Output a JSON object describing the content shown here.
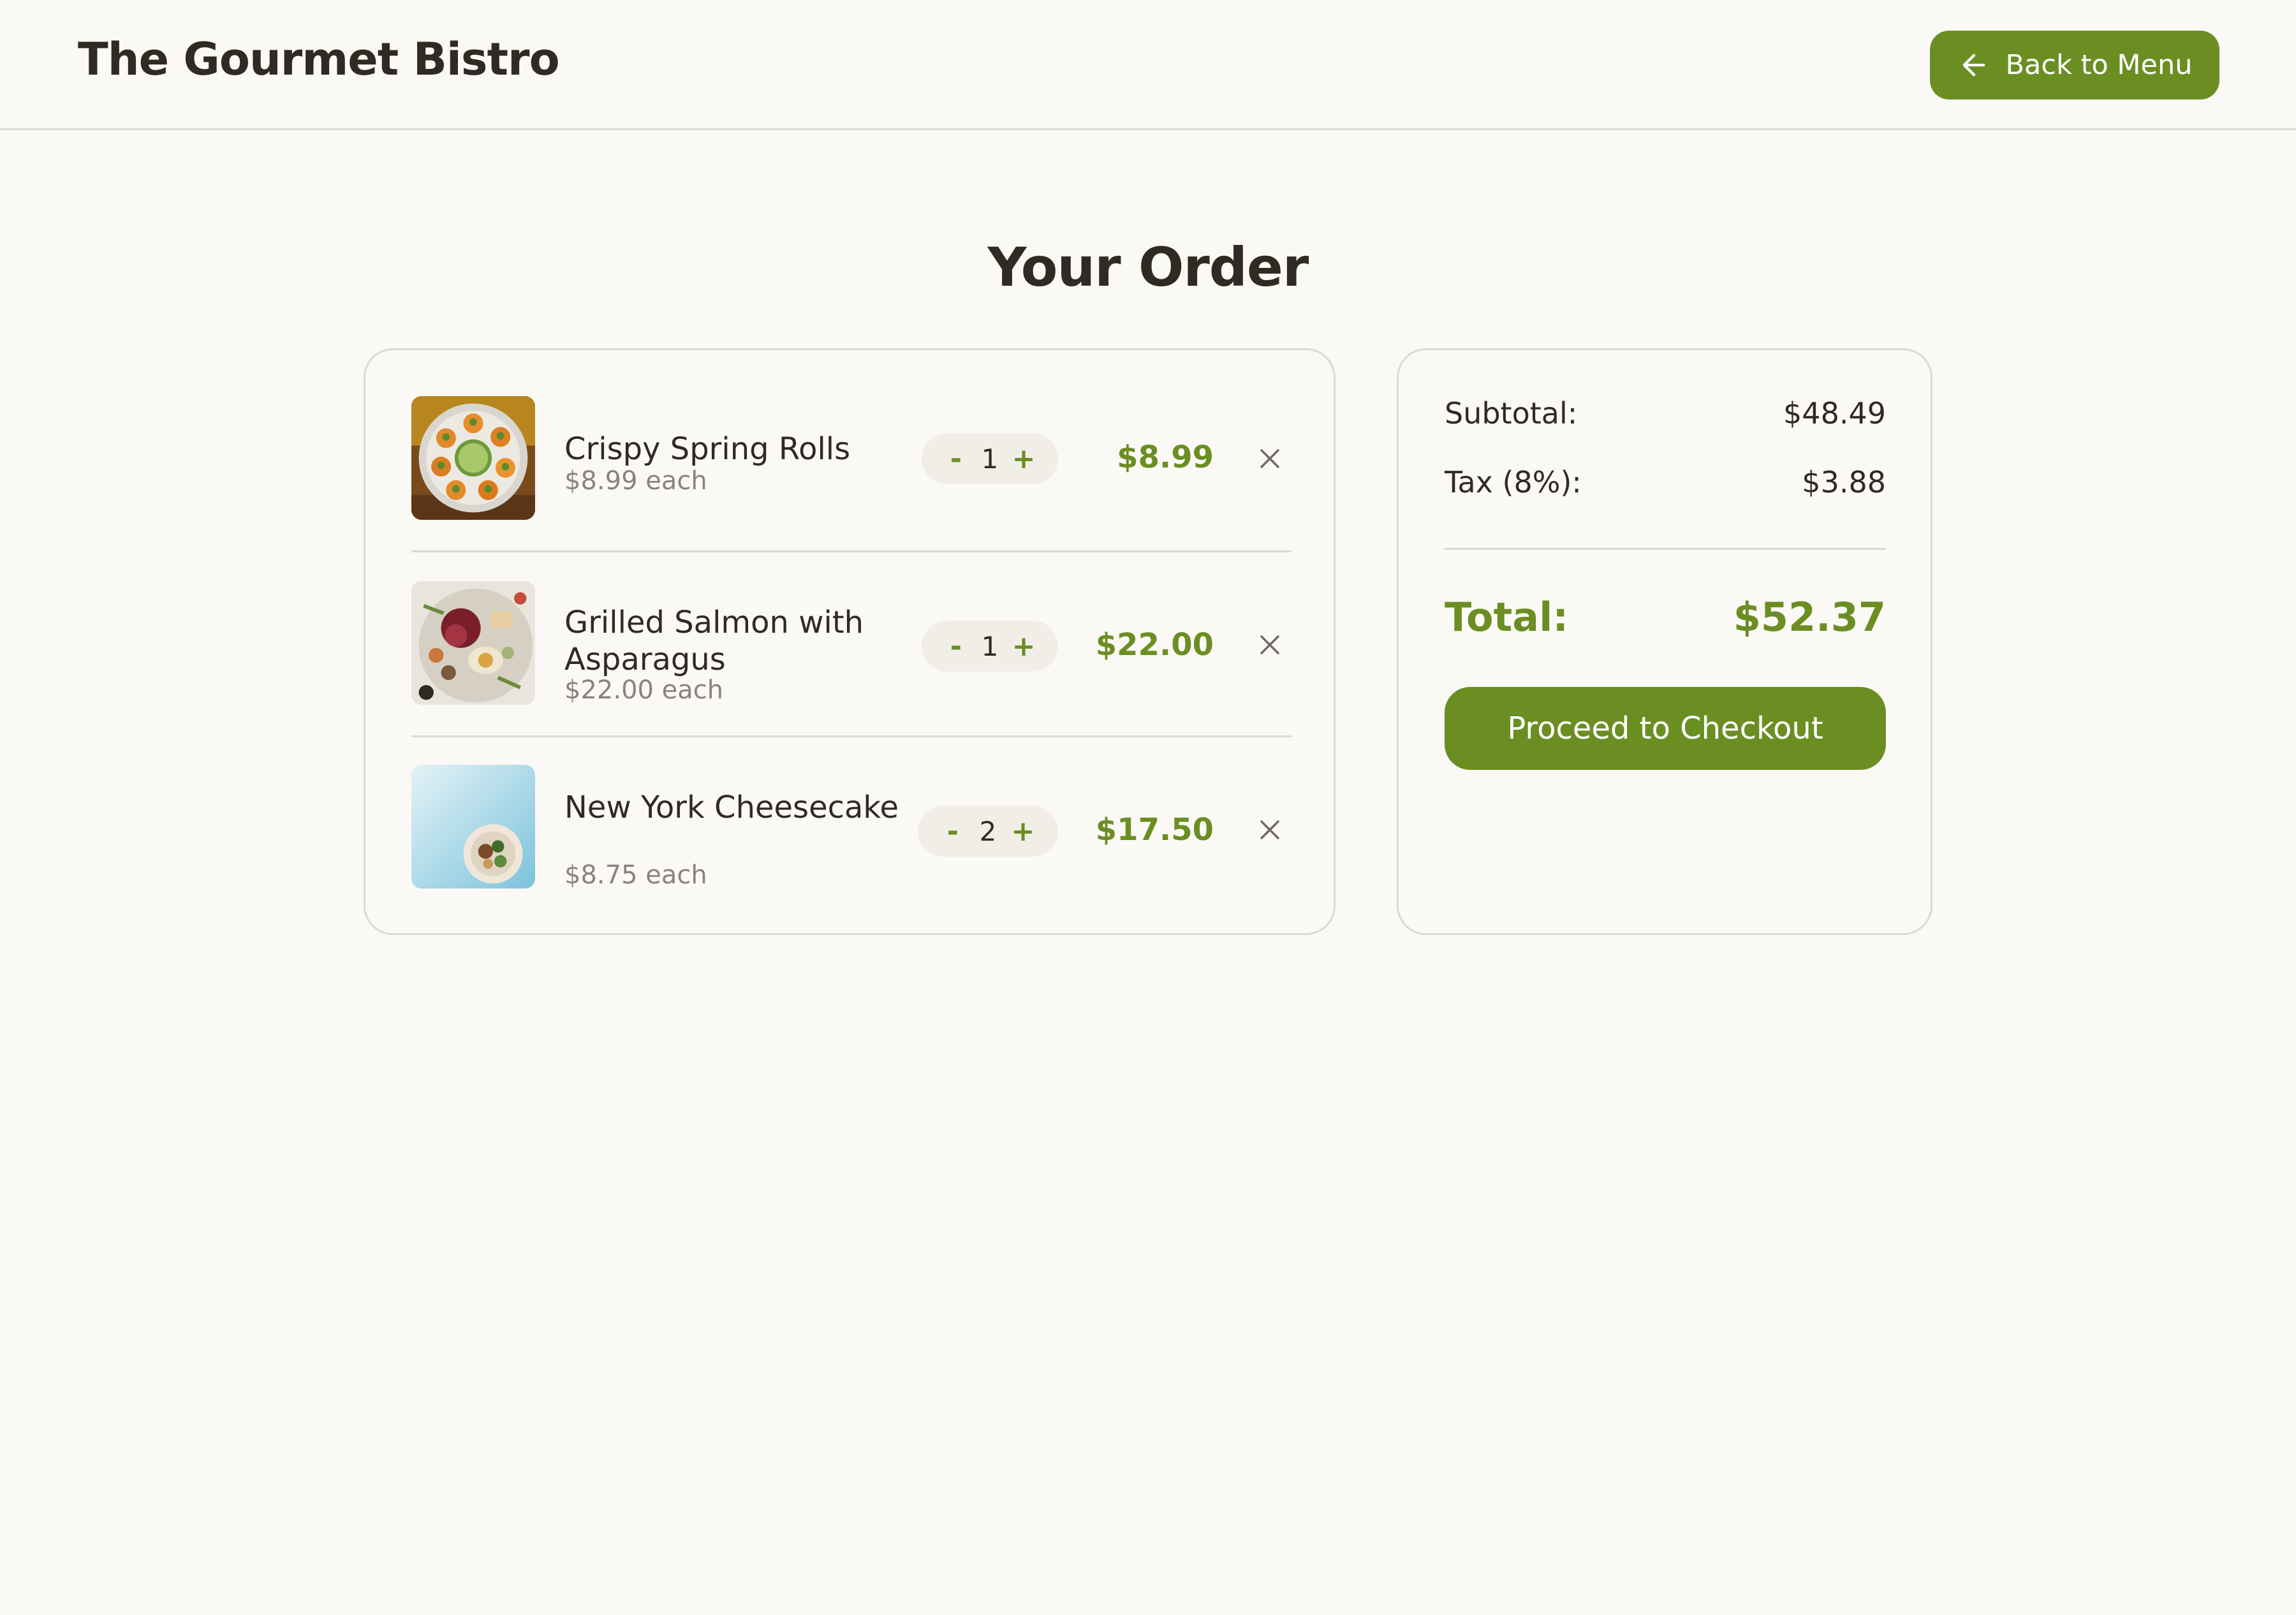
{
  "header": {
    "brand": "The Gourmet Bistro",
    "back_label": "Back to Menu"
  },
  "page_title": "Your Order",
  "order_items": [
    {
      "name": "Crispy Spring Rolls",
      "each": "$8.99 each",
      "qty": "1",
      "line_price": "$8.99",
      "thumb_icon": "spring-rolls-photo"
    },
    {
      "name": "Grilled Salmon with Asparagus",
      "each": "$22.00 each",
      "qty": "1",
      "line_price": "$22.00",
      "thumb_icon": "salmon-platter-photo"
    },
    {
      "name": "New York Cheesecake",
      "each": "$8.75 each",
      "qty": "2",
      "line_price": "$17.50",
      "thumb_icon": "cheesecake-bowl-photo"
    }
  ],
  "qty_controls": {
    "minus": "-",
    "plus": "+"
  },
  "summary": {
    "subtotal_label": "Subtotal:",
    "subtotal_value": "$48.49",
    "tax_label": "Tax (8%):",
    "tax_value": "$3.88",
    "total_label": "Total:",
    "total_value": "$52.37",
    "checkout_label": "Proceed to Checkout"
  },
  "colors": {
    "accent": "#6b8e23",
    "background": "#fbf9f5",
    "text": "#2f2a22",
    "muted": "#8a8478",
    "border": "#dcd9d3"
  }
}
